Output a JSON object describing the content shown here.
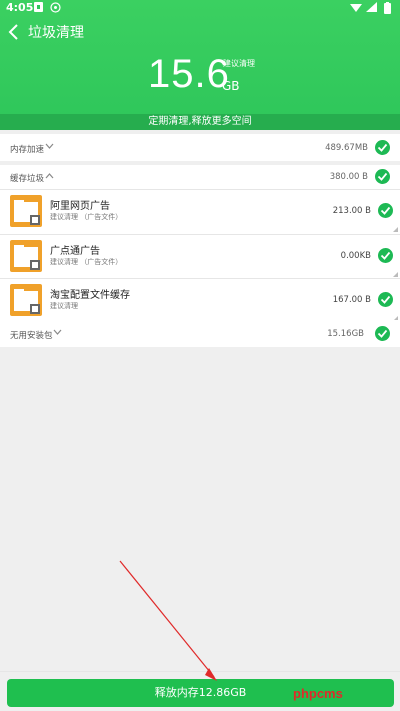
{
  "status": {
    "time": "4:05"
  },
  "header": {
    "title": "垃圾清理",
    "total_size": "15.6",
    "unit": "GB",
    "suggest": "建议清理",
    "tip": "定期清理,释放更多空间"
  },
  "sections": {
    "memory": {
      "label": "内存加速",
      "size": "489.67MB"
    },
    "cache": {
      "label": "缓存垃圾",
      "size": "380.00 B"
    },
    "apk": {
      "label": "无用安装包",
      "size": "15.16GB"
    }
  },
  "cache_items": [
    {
      "name": "阿里网页广告",
      "desc": "建议清理 （广告文件）",
      "size": "213.00 B"
    },
    {
      "name": "广点通广告",
      "desc": "建议清理 （广告文件）",
      "size": "0.00KB"
    },
    {
      "name": "淘宝配置文件缓存",
      "desc": "建议清理",
      "size": "167.00 B"
    }
  ],
  "bottom": {
    "button": "释放内存12.86GB",
    "watermark": "phpcms"
  },
  "colors": {
    "primary": "#2ec65a",
    "check": "#1db954",
    "folder": "#f0a12a",
    "annotation": "#e02a2a"
  }
}
